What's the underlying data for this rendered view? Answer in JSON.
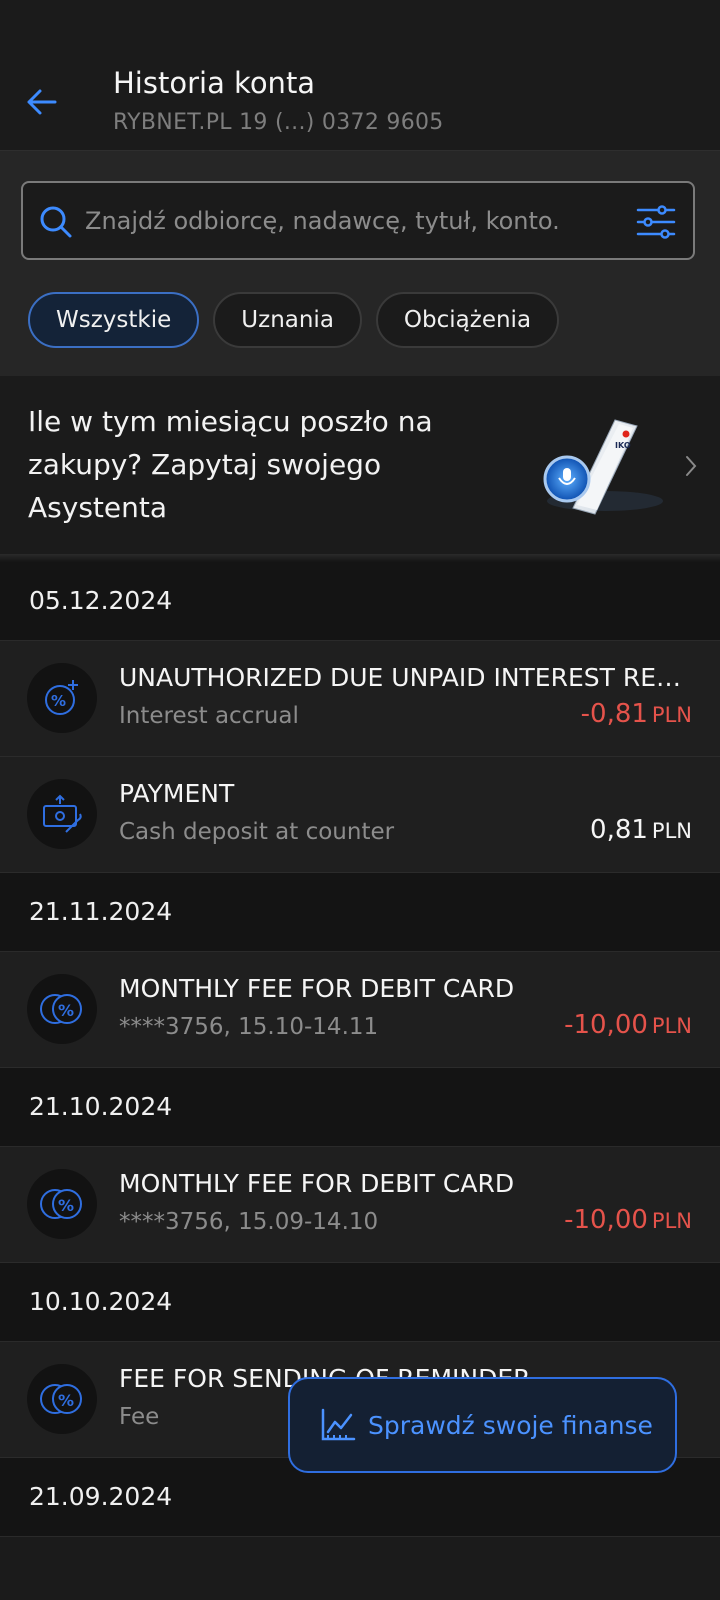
{
  "header": {
    "title": "Historia konta",
    "account": "RYBNET.PL 19 (...) 0372 9605"
  },
  "search": {
    "placeholder": "Znajdź odbiorcę, nadawcę, tytuł, konto."
  },
  "filters": {
    "chips": [
      "Wszystkie",
      "Uznania",
      "Obciążenia"
    ],
    "active": "Wszystkie"
  },
  "promo": {
    "text": "Ile w tym miesiącu poszło na zakupy? Zapytaj swojego Asystenta",
    "image_label": "IKO"
  },
  "groups": [
    {
      "date": "05.12.2024",
      "items": [
        {
          "icon": "interest-icon",
          "title": "UNAUTHORIZED DUE UNPAID INTEREST REPA...",
          "subtitle": "Interest accrual",
          "amount": "-0,81",
          "currency": "PLN",
          "negative": true
        },
        {
          "icon": "cash-deposit-icon",
          "title": "PAYMENT",
          "subtitle": "Cash deposit at counter",
          "amount": "0,81",
          "currency": "PLN",
          "negative": false
        }
      ]
    },
    {
      "date": "21.11.2024",
      "items": [
        {
          "icon": "fee-icon",
          "title": "MONTHLY FEE FOR DEBIT CARD",
          "subtitle": "****3756, 15.10-14.11",
          "amount": "-10,00",
          "currency": "PLN",
          "negative": true
        }
      ]
    },
    {
      "date": "21.10.2024",
      "items": [
        {
          "icon": "fee-icon",
          "title": "MONTHLY FEE FOR DEBIT CARD",
          "subtitle": "****3756, 15.09-14.10",
          "amount": "-10,00",
          "currency": "PLN",
          "negative": true
        }
      ]
    },
    {
      "date": "10.10.2024",
      "items": [
        {
          "icon": "fee-icon",
          "title": "FEE FOR SENDING OF REMINDER",
          "subtitle": "Fee",
          "amount": "",
          "currency": "",
          "negative": true
        }
      ]
    },
    {
      "date": "21.09.2024",
      "items": []
    }
  ],
  "fab": {
    "label": "Sprawdź swoje finanse",
    "icon": "chart-icon"
  },
  "colors": {
    "accent": "#2f6ee0",
    "accent_text": "#4b92ff",
    "negative": "#e5534b",
    "background": "#1b1b1b"
  }
}
